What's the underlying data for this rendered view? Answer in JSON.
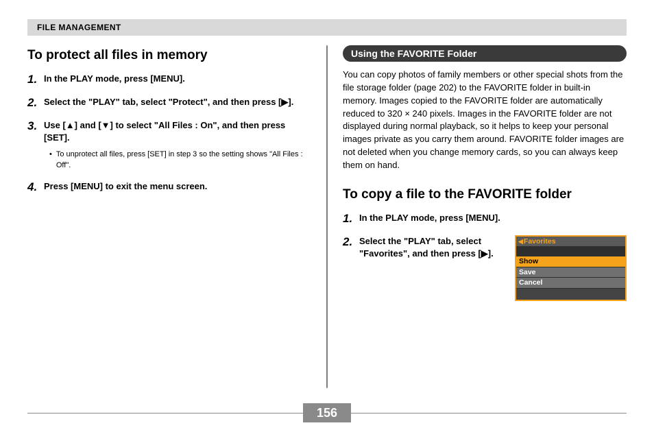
{
  "header": {
    "section": "FILE MANAGEMENT"
  },
  "left": {
    "heading": "To protect all files in memory",
    "steps": [
      {
        "n": "1.",
        "text": "In the PLAY mode, press [MENU]."
      },
      {
        "n": "2.",
        "text": "Select the \"PLAY\" tab, select \"Protect\", and then press [▶]."
      },
      {
        "n": "3.",
        "text": "Use [▲] and [▼] to select \"All Files : On\", and then press [SET].",
        "sub": "To unprotect all files, press [SET] in step 3 so the setting shows \"All Files : Off\"."
      },
      {
        "n": "4.",
        "text": "Press [MENU] to exit the menu screen."
      }
    ]
  },
  "right": {
    "pill": "Using the FAVORITE Folder",
    "intro": "You can copy photos of family members or other special shots from the file storage folder (page 202) to the FAVORITE folder in built-in memory. Images copied to the FAVORITE folder are automatically reduced to 320 × 240 pixels. Images in the FAVORITE folder are not displayed during normal playback, so it helps to keep your personal images private as you carry them around. FAVORITE folder images are not deleted when you change memory cards, so you can always keep them on hand.",
    "heading": "To copy a file to the FAVORITE folder",
    "steps": [
      {
        "n": "1.",
        "text": "In the PLAY mode, press [MENU]."
      },
      {
        "n": "2.",
        "text": "Select the \"PLAY\" tab, select \"Favorites\", and then press [▶]."
      }
    ],
    "menu": {
      "title": "Favorites",
      "options": [
        "Show",
        "Save",
        "Cancel"
      ],
      "selected_index": 0
    }
  },
  "page_number": "156"
}
